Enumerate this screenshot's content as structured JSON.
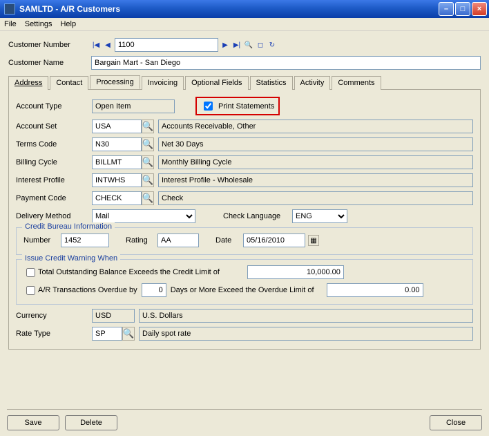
{
  "window": {
    "title": "SAMLTD - A/R Customers"
  },
  "menu": {
    "file": "File",
    "settings": "Settings",
    "help": "Help"
  },
  "header": {
    "customer_number_label": "Customer Number",
    "customer_number": "1100",
    "customer_name_label": "Customer Name",
    "customer_name": "Bargain Mart - San Diego"
  },
  "tabs": {
    "address": "Address",
    "contact": "Contact",
    "processing": "Processing",
    "invoicing": "Invoicing",
    "optional": "Optional Fields",
    "statistics": "Statistics",
    "activity": "Activity",
    "comments": "Comments"
  },
  "processing": {
    "account_type_label": "Account Type",
    "account_type": "Open Item",
    "print_statements_label": "Print Statements",
    "print_statements_checked": true,
    "account_set_label": "Account Set",
    "account_set": "USA",
    "account_set_desc": "Accounts Receivable, Other",
    "terms_code_label": "Terms Code",
    "terms_code": "N30",
    "terms_code_desc": "Net 30 Days",
    "billing_cycle_label": "Billing Cycle",
    "billing_cycle": "BILLMT",
    "billing_cycle_desc": "Monthly Billing Cycle",
    "interest_profile_label": "Interest Profile",
    "interest_profile": "INTWHS",
    "interest_profile_desc": "Interest Profile - Wholesale",
    "payment_code_label": "Payment Code",
    "payment_code": "CHECK",
    "payment_code_desc": "Check",
    "delivery_method_label": "Delivery Method",
    "delivery_method": "Mail",
    "check_language_label": "Check Language",
    "check_language": "ENG",
    "credit_bureau": {
      "legend": "Credit Bureau Information",
      "number_label": "Number",
      "number": "1452",
      "rating_label": "Rating",
      "rating": "AA",
      "date_label": "Date",
      "date": "05/16/2010"
    },
    "credit_warning": {
      "legend": "Issue Credit Warning When",
      "balance_label": "Total Outstanding Balance Exceeds the Credit Limit of",
      "balance_limit": "10,000.00",
      "overdue_prefix": "A/R Transactions Overdue by",
      "overdue_days": "0",
      "overdue_suffix": "Days or More Exceed the Overdue Limit of",
      "overdue_limit": "0.00"
    },
    "currency_label": "Currency",
    "currency": "USD",
    "currency_desc": "U.S. Dollars",
    "rate_type_label": "Rate Type",
    "rate_type": "SP",
    "rate_type_desc": "Daily spot rate"
  },
  "buttons": {
    "save": "Save",
    "delete": "Delete",
    "close": "Close"
  }
}
